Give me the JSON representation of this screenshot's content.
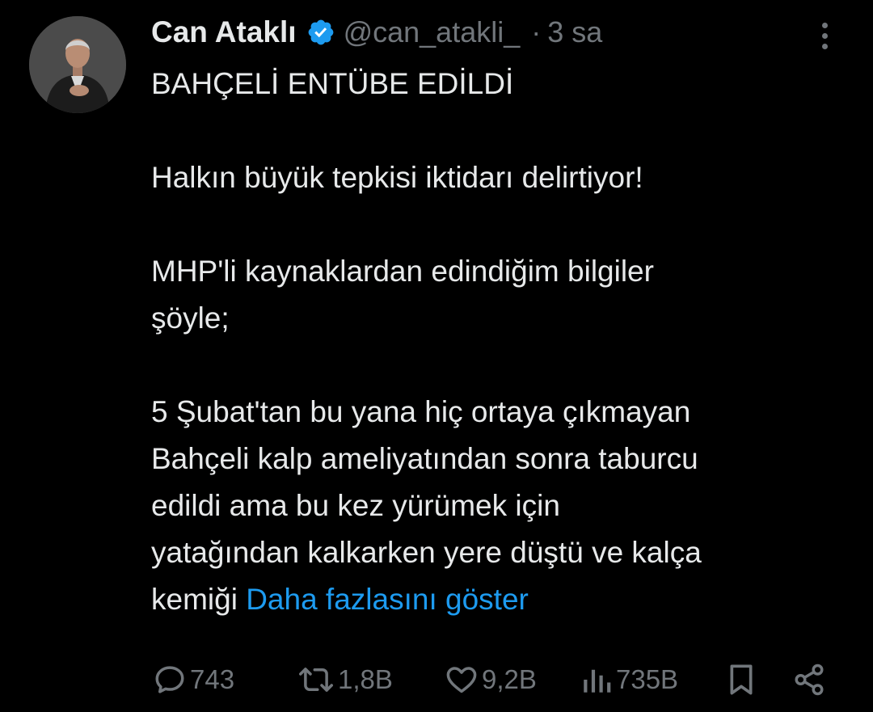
{
  "tweet": {
    "author": {
      "display_name": "Can Ataklı",
      "handle": "@can_atakli_",
      "separator": "·",
      "time": "3 sa"
    },
    "body": {
      "line1": "BAHÇELİ ENTÜBE EDİLDİ",
      "line2": "Halkın büyük tepkisi iktidarı delirtiyor!",
      "line3": "MHP'li kaynaklardan edindiğim bilgiler",
      "line4": "şöyle;",
      "line5": "5 Şubat'tan bu yana hiç ortaya çıkmayan",
      "line6": "Bahçeli kalp ameliyatından sonra taburcu",
      "line7": "edildi ama bu kez yürümek için",
      "line8": "yatağından kalkarken yere düştü ve kalça",
      "line9": "kemiği",
      "show_more": "Daha fazlasını göster"
    },
    "stats": {
      "replies": "743",
      "retweets": "1,8B",
      "likes": "9,2B",
      "views": "735B"
    }
  },
  "colors": {
    "background": "#000000",
    "text": "#e7e9ea",
    "secondary": "#71767b",
    "link": "#1d9bf0",
    "verified": "#1d9bf0"
  },
  "icons": [
    "verified-badge-icon",
    "more-options-icon",
    "reply-icon",
    "retweet-icon",
    "like-icon",
    "views-icon",
    "bookmark-icon",
    "share-icon"
  ]
}
